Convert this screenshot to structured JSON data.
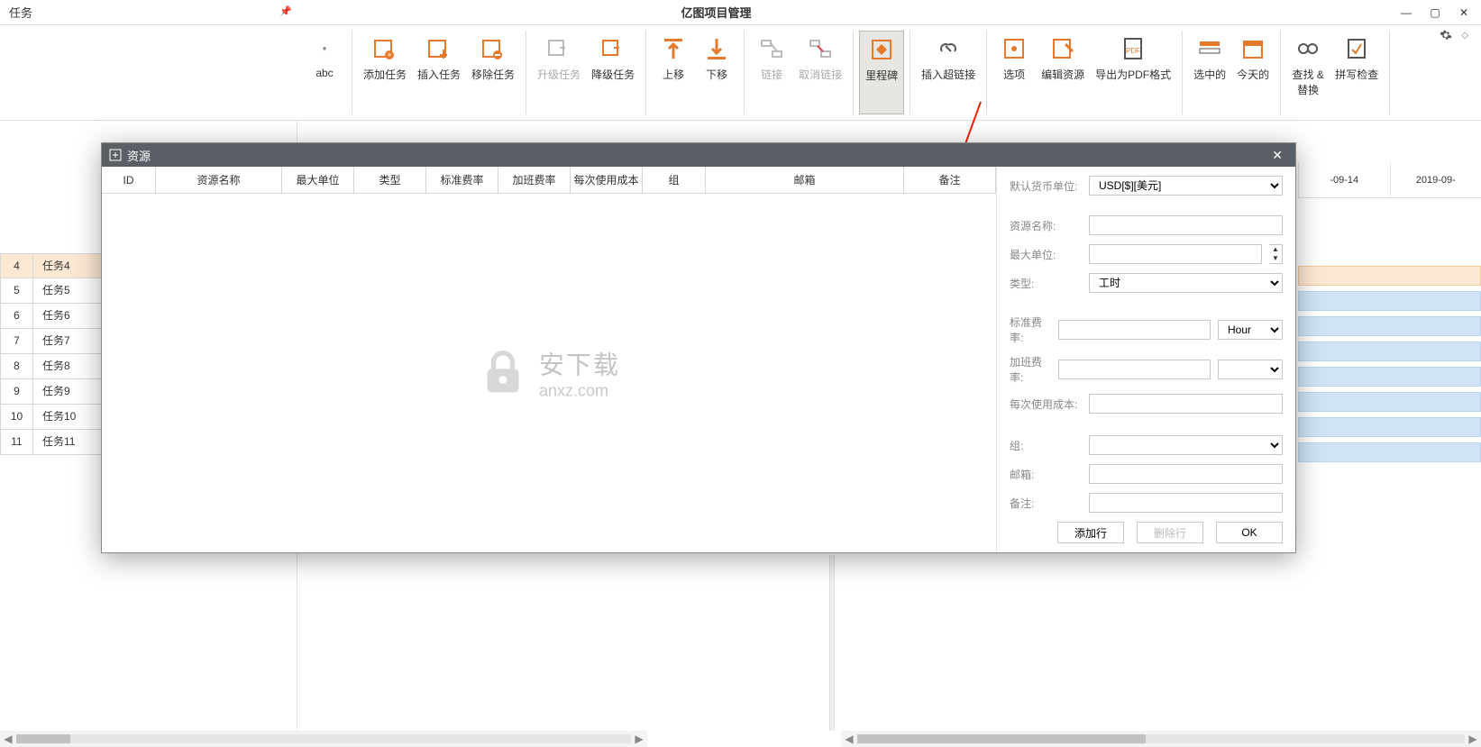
{
  "window": {
    "side_title": "任务",
    "app_title": "亿图项目管理"
  },
  "ribbon": {
    "abc_label": "abc",
    "add_task": "添加任务",
    "insert_task": "插入任务",
    "remove_task": "移除任务",
    "upgrade_task": "升级任务",
    "degrade_task": "降级任务",
    "move_up": "上移",
    "move_down": "下移",
    "link": "链接",
    "unlink": "取消链接",
    "milestone": "里程碑",
    "insert_hyperlink": "插入超链接",
    "options": "选项",
    "edit_resource": "编辑资源",
    "export_pdf": "导出为PDF格式",
    "selected": "选中的",
    "today": "今天的",
    "find_replace_1": "查找 &",
    "find_replace_2": "替换",
    "spell_check": "拼写检查"
  },
  "tasks": [
    {
      "idx": "4",
      "name": "任务4",
      "selected": true
    },
    {
      "idx": "5",
      "name": "任务5",
      "selected": false
    },
    {
      "idx": "6",
      "name": "任务6",
      "selected": false
    },
    {
      "idx": "7",
      "name": "任务7",
      "selected": false
    },
    {
      "idx": "8",
      "name": "任务8",
      "selected": false
    },
    {
      "idx": "9",
      "name": "任务9",
      "selected": false
    },
    {
      "idx": "10",
      "name": "任务10",
      "selected": false
    },
    {
      "idx": "11",
      "name": "任务11",
      "selected": false
    }
  ],
  "gantt": {
    "col1": "-09-14",
    "col2": "2019-09-"
  },
  "dialog": {
    "title": "资源",
    "columns": {
      "id": "ID",
      "res_name": "资源名称",
      "max_units": "最大单位",
      "type": "类型",
      "std_rate": "标准费率",
      "ot_rate": "加班费率",
      "cost_per_use": "每次使用成本",
      "group": "组",
      "email": "邮箱",
      "notes": "备注"
    },
    "default_currency_label": "默认货币单位:",
    "default_currency_value": "USD[$][美元]",
    "form": {
      "res_name": "资源名称:",
      "max_units": "最大单位:",
      "type": "类型:",
      "type_value": "工时",
      "std_rate": "标准费率:",
      "std_rate_unit": "Hour",
      "ot_rate": "加班费率:",
      "cost_per_use": "每次使用成本:",
      "group": "组:",
      "email": "邮箱:",
      "notes": "备注:"
    },
    "buttons": {
      "add_row": "添加行",
      "delete_row": "删除行",
      "ok": "OK"
    }
  },
  "watermark": {
    "line1": "安下载",
    "line2": "anxz.com"
  }
}
